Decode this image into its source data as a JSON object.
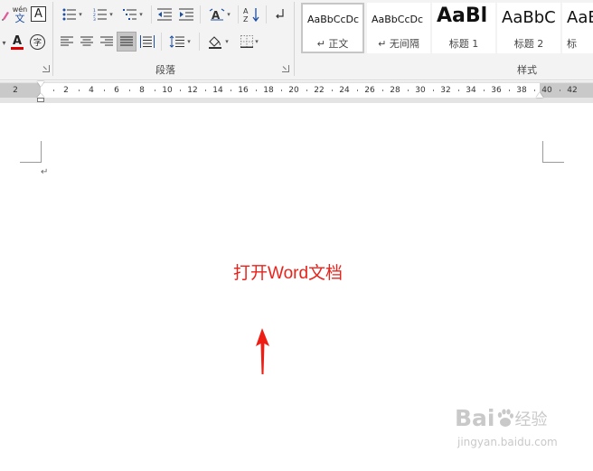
{
  "ribbon": {
    "paragraph_group_label": "段落",
    "styles_group_label": "样式",
    "font_row1": {
      "phonetic_top": "wén",
      "phonetic_bottom": "文",
      "char_border": "A"
    },
    "font_row2": {
      "font_color": "A",
      "enclose_char": "字"
    },
    "sort_label": "A↓Z",
    "styles": [
      {
        "sample": "AaBbCcDc",
        "name": "↵ 正文",
        "selected": true
      },
      {
        "sample": "AaBbCcDc",
        "name": "↵ 无间隔",
        "selected": false
      },
      {
        "sample": "AaBl",
        "name": "标题 1",
        "selected": false
      },
      {
        "sample": "AaBbC",
        "name": "标题 2",
        "selected": false
      },
      {
        "sample": "AaB",
        "name": "标",
        "selected": false
      }
    ]
  },
  "ruler": {
    "numbers": [
      "2",
      "2",
      "4",
      "6",
      "8",
      "10",
      "12",
      "14",
      "16",
      "18",
      "20",
      "22",
      "24",
      "26",
      "28",
      "30",
      "32",
      "34",
      "36",
      "38",
      "40",
      "42"
    ]
  },
  "document": {
    "paragraph_mark": "↵",
    "annotation": "打开Word文档"
  },
  "watermark": {
    "logo_left": "Bai",
    "logo_right": "经验",
    "url": "jingyan.baidu.com"
  },
  "colors": {
    "annotation": "#e8231c",
    "ribbon_bg": "#f3f3f3",
    "ruler_margin": "#c9c9c9"
  }
}
